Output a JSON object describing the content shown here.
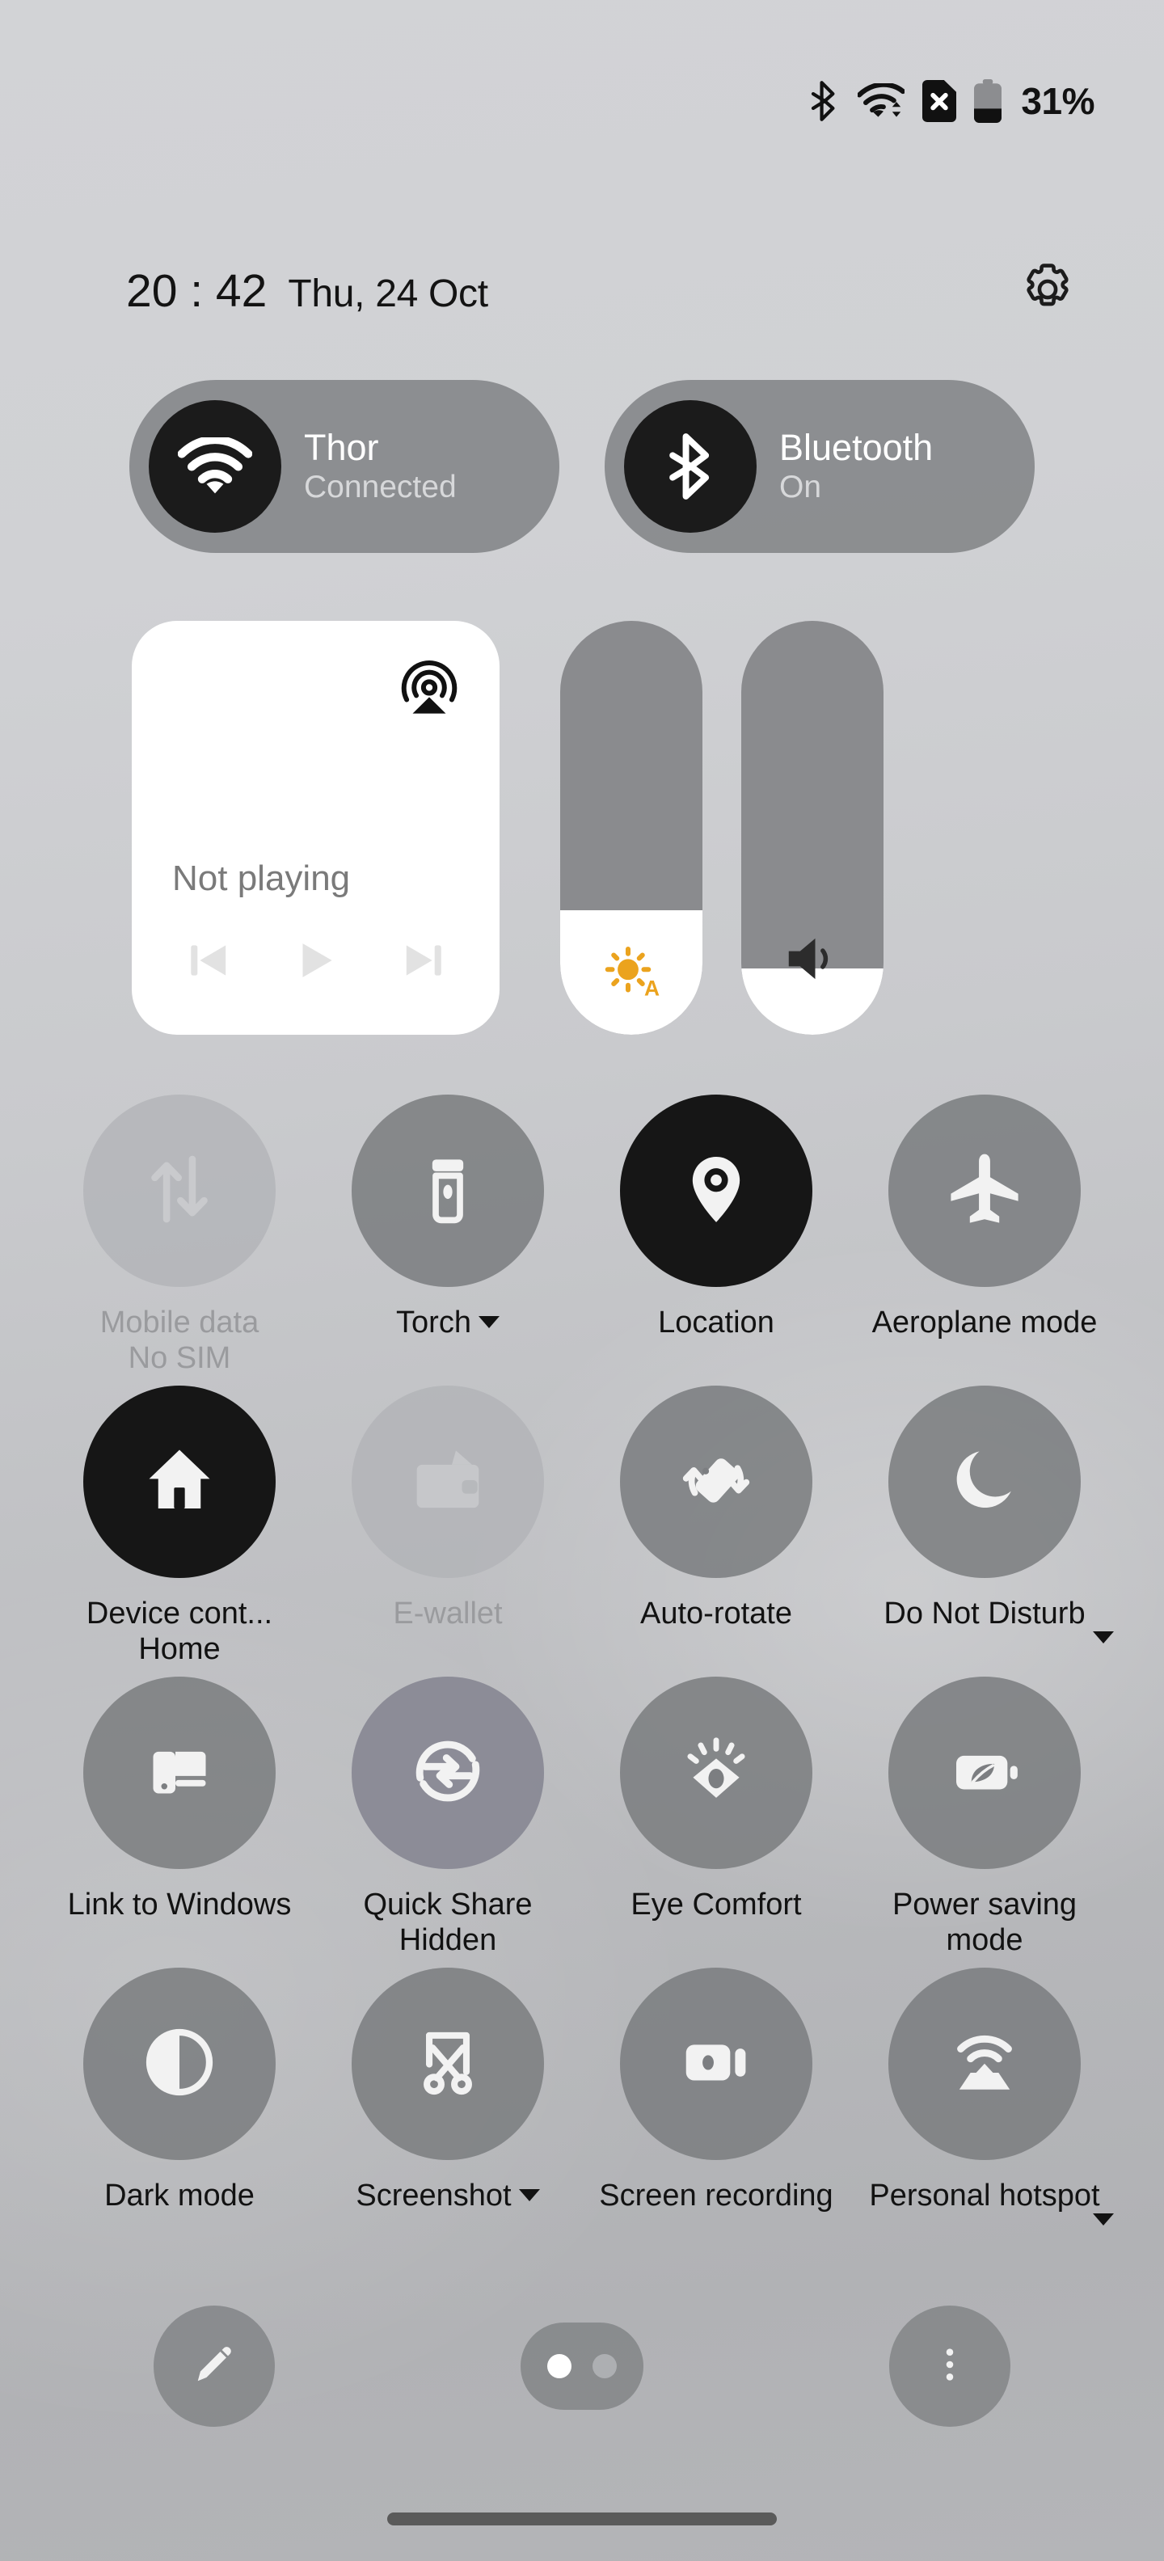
{
  "status_bar": {
    "icons": [
      "bluetooth-icon",
      "wifi-icon",
      "sim-card-off-icon",
      "battery-icon"
    ],
    "battery_percent": "31%"
  },
  "header": {
    "time": "20 : 42",
    "date": "Thu, 24 Oct",
    "settings_icon": "gear-icon"
  },
  "connectivity": {
    "wifi": {
      "icon": "wifi-icon",
      "title": "Thor",
      "subtitle": "Connected"
    },
    "bluetooth": {
      "icon": "bluetooth-icon",
      "title": "Bluetooth",
      "subtitle": "On"
    }
  },
  "media": {
    "cast_icon": "cast-audio-icon",
    "title": "Not playing",
    "controls": [
      {
        "name": "previous-track-button",
        "icon": "skip-previous-icon"
      },
      {
        "name": "play-button",
        "icon": "play-icon"
      },
      {
        "name": "next-track-button",
        "icon": "skip-next-icon"
      }
    ]
  },
  "sliders": {
    "brightness": {
      "icon": "brightness-auto-icon",
      "level_percent": 30,
      "auto_label": "A",
      "accent_color": "#eba31e"
    },
    "volume": {
      "icon": "volume-icon",
      "level_percent": 16
    }
  },
  "tiles": [
    {
      "name": "tile-mobile-data",
      "icon": "mobile-data-icon",
      "label": "Mobile data",
      "sublabel": "No SIM",
      "state": "disabled",
      "has_caret": false
    },
    {
      "name": "tile-torch",
      "icon": "flashlight-icon",
      "label": "Torch",
      "sublabel": "",
      "state": "off",
      "has_caret": true,
      "caret_style": "inline"
    },
    {
      "name": "tile-location",
      "icon": "location-pin-icon",
      "label": "Location",
      "sublabel": "",
      "state": "on",
      "has_caret": false
    },
    {
      "name": "tile-aeroplane-mode",
      "icon": "airplane-icon",
      "label": "Aeroplane mode",
      "sublabel": "",
      "state": "off",
      "has_caret": false
    },
    {
      "name": "tile-device-controls",
      "icon": "home-icon",
      "label": "Device cont...",
      "sublabel": "Home",
      "state": "on",
      "has_caret": false
    },
    {
      "name": "tile-e-wallet",
      "icon": "wallet-icon",
      "label": "E-wallet",
      "sublabel": "",
      "state": "disabled",
      "has_caret": false
    },
    {
      "name": "tile-auto-rotate",
      "icon": "auto-rotate-icon",
      "label": "Auto-rotate",
      "sublabel": "",
      "state": "off",
      "has_caret": false
    },
    {
      "name": "tile-do-not-disturb",
      "icon": "moon-icon",
      "label": "Do Not Disturb",
      "sublabel": "",
      "state": "off",
      "has_caret": true,
      "caret_style": "side"
    },
    {
      "name": "tile-link-to-windows",
      "icon": "link-to-windows-icon",
      "label": "Link to Windows",
      "sublabel": "",
      "state": "off",
      "has_caret": false
    },
    {
      "name": "tile-quick-share",
      "icon": "quick-share-icon",
      "label": "Quick Share",
      "sublabel": "Hidden",
      "state": "tinted",
      "has_caret": false
    },
    {
      "name": "tile-eye-comfort",
      "icon": "eye-comfort-icon",
      "label": "Eye Comfort",
      "sublabel": "",
      "state": "off",
      "has_caret": false
    },
    {
      "name": "tile-power-saving-mode",
      "icon": "battery-leaf-icon",
      "label": "Power saving mode",
      "sublabel": "",
      "state": "off",
      "has_caret": false
    },
    {
      "name": "tile-dark-mode",
      "icon": "contrast-circle-icon",
      "label": "Dark mode",
      "sublabel": "",
      "state": "off",
      "has_caret": false
    },
    {
      "name": "tile-screenshot",
      "icon": "scissors-screenshot-icon",
      "label": "Screenshot",
      "sublabel": "",
      "state": "off",
      "has_caret": true,
      "caret_style": "inline"
    },
    {
      "name": "tile-screen-recording",
      "icon": "video-camera-icon",
      "label": "Screen recording",
      "sublabel": "",
      "state": "off",
      "has_caret": false
    },
    {
      "name": "tile-personal-hotspot",
      "icon": "hotspot-icon",
      "label": "Personal hotspot",
      "sublabel": "",
      "state": "off",
      "has_caret": true,
      "caret_style": "side"
    }
  ],
  "bottom_bar": {
    "edit_button_icon": "pencil-icon",
    "more_button_icon": "more-vertical-icon",
    "pages": {
      "total": 2,
      "active_index": 0
    }
  }
}
